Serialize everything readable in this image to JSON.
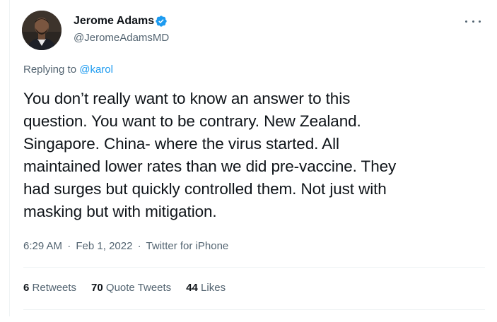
{
  "author": {
    "name": "Jerome Adams",
    "handle": "@JeromeAdamsMD",
    "verified": true
  },
  "reply": {
    "prefix": "Replying to ",
    "mention": "@karol"
  },
  "tweet": {
    "text": "You don’t really want to know an answer to this\nquestion. You want to be contrary. New Zealand.\nSingapore. China- where the virus started. All\nmaintained lower rates than we did pre-vaccine. They\nhad surges but quickly controlled them. Not just with\nmasking but with mitigation."
  },
  "meta": {
    "time": "6:29 AM",
    "separator": "·",
    "date": "Feb 1, 2022",
    "source": "Twitter for iPhone"
  },
  "stats": {
    "retweets": {
      "count": "6",
      "label": "Retweets"
    },
    "quotes": {
      "count": "70",
      "label": "Quote Tweets"
    },
    "likes": {
      "count": "44",
      "label": "Likes"
    }
  },
  "colors": {
    "accent": "#1d9bf0",
    "text": "#0f1419",
    "secondary": "#536471",
    "border": "#eff3f4"
  },
  "icons": {
    "verified": "verified-badge-icon",
    "more": "more-horizontal-icon"
  }
}
